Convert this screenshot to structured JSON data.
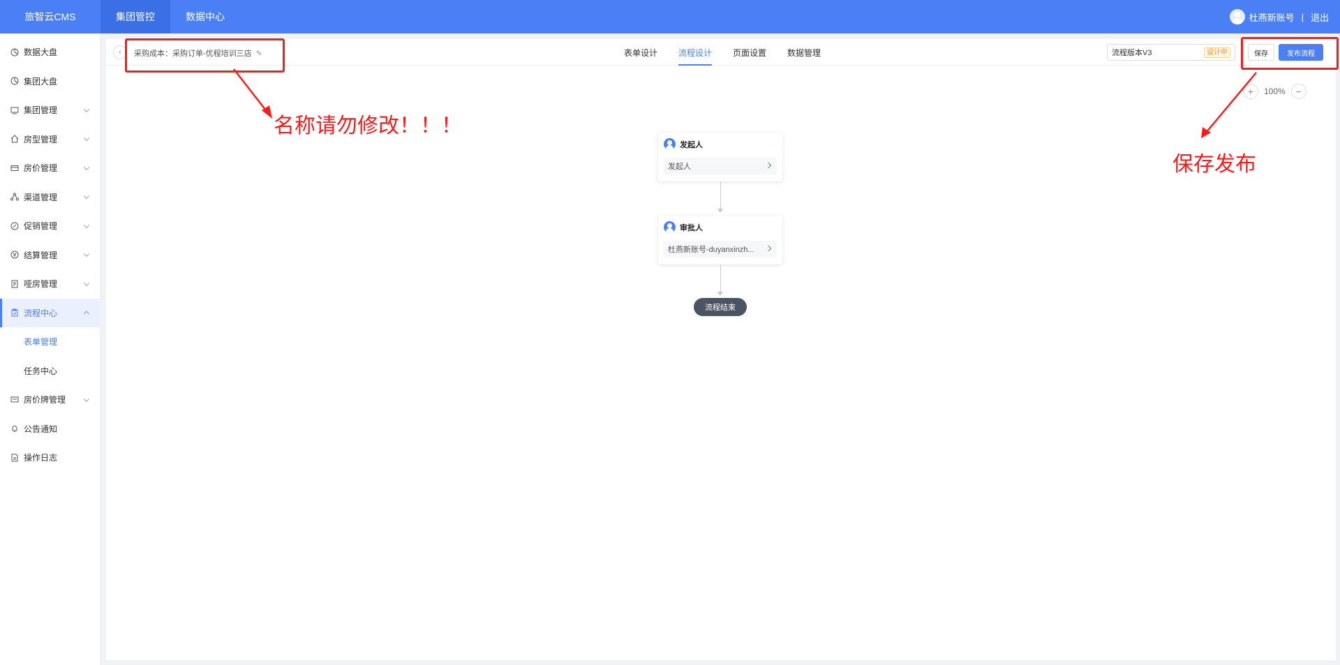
{
  "app": {
    "title": "旅智云CMS"
  },
  "topnav": [
    {
      "label": "集团管控",
      "active": true
    },
    {
      "label": "数据中心",
      "active": false
    }
  ],
  "user": {
    "name": "杜燕新账号",
    "sep": "|",
    "logout": "退出"
  },
  "sidebar": {
    "items": [
      {
        "label": "数据大盘",
        "icon": "chart-icon"
      },
      {
        "label": "集团大盘",
        "icon": "chart-icon"
      },
      {
        "label": "集团管理",
        "icon": "group-icon"
      },
      {
        "label": "房型管理",
        "icon": "home-icon"
      },
      {
        "label": "房价管理",
        "icon": "card-icon"
      },
      {
        "label": "渠道管理",
        "icon": "channel-icon"
      },
      {
        "label": "促销管理",
        "icon": "promo-icon"
      },
      {
        "label": "结算管理",
        "icon": "yen-icon"
      },
      {
        "label": "哑房管理",
        "icon": "doc-icon"
      },
      {
        "label": "流程中心",
        "icon": "clipboard-icon"
      },
      {
        "label": "表单管理"
      },
      {
        "label": "任务中心"
      },
      {
        "label": "房价牌管理",
        "icon": "board-icon"
      },
      {
        "label": "公告通知",
        "icon": "bell-icon"
      },
      {
        "label": "操作日志",
        "icon": "log-icon"
      }
    ]
  },
  "header": {
    "back_symbol": "‹",
    "form_name": "采购成本：采购订单-优程培训三店",
    "edit_symbol": "✎",
    "tabs": [
      {
        "label": "表单设计"
      },
      {
        "label": "流程设计"
      },
      {
        "label": "页面设置"
      },
      {
        "label": "数据管理"
      }
    ],
    "version_value": "流程版本V3",
    "version_status": "设计中",
    "save_label": "保存",
    "publish_label": "发布流程"
  },
  "zoom": {
    "plus": "+",
    "level": "100%",
    "minus": "−"
  },
  "flow": {
    "nodes": [
      {
        "title": "发起人",
        "content": "发起人"
      },
      {
        "title": "审批人",
        "content": "杜燕新账号-duyanxinzh..."
      }
    ],
    "end_label": "流程结束"
  },
  "annotations": {
    "name_warning": "名称请勿修改！！！",
    "save_publish": "保存发布"
  },
  "colors": {
    "primary": "#4a7ff5",
    "annotation": "#ff1a1a",
    "end_node": "#4a5463"
  }
}
